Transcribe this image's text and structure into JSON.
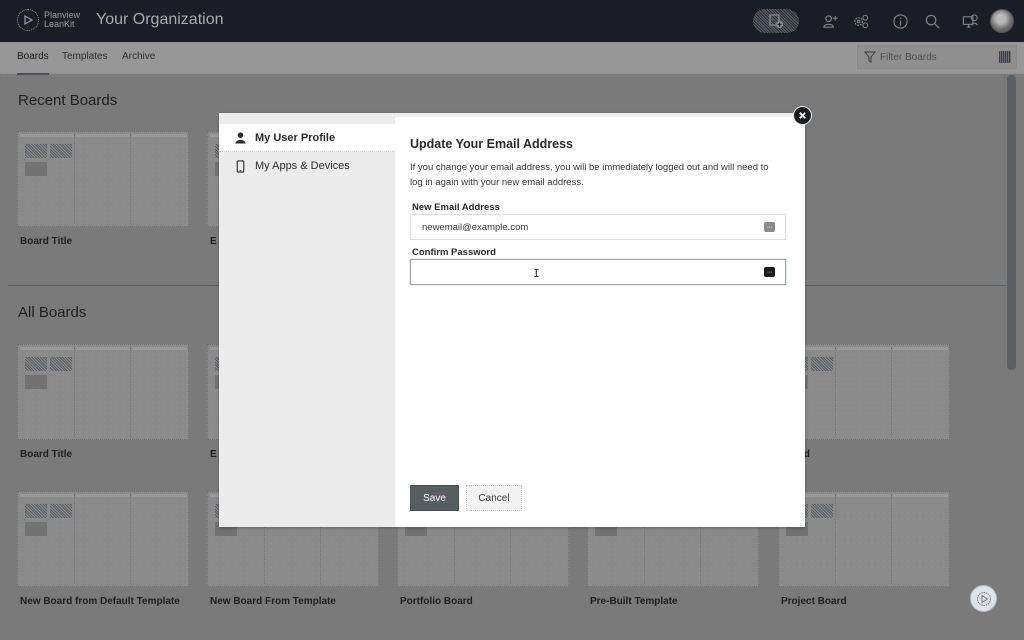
{
  "header": {
    "logo_line1": "Planview",
    "logo_line2": "LeanKit",
    "org_title": "Your Organization",
    "icons": [
      "add-board-icon",
      "invite-user-icon",
      "settings-icon",
      "info-icon",
      "search-icon",
      "support-icon",
      "user-avatar"
    ]
  },
  "subnav": {
    "tabs": [
      {
        "label": "Boards",
        "active": true
      },
      {
        "label": "Templates",
        "active": false
      },
      {
        "label": "Archive",
        "active": false
      }
    ],
    "filter_placeholder": "Filter Boards"
  },
  "content": {
    "recent_title": "Recent Boards",
    "all_title": "All Boards",
    "recent_boards": [
      {
        "title": "Board Title"
      },
      {
        "title": "E"
      }
    ],
    "all_boards_row1": [
      {
        "title": "Board Title"
      },
      {
        "title": "E"
      },
      {
        "title": "Board"
      }
    ],
    "all_boards_row2": [
      {
        "title": "New Board from Default Template"
      },
      {
        "title": "New Board From Template"
      },
      {
        "title": "Portfolio Board"
      },
      {
        "title": "Pre-Built Template"
      },
      {
        "title": "Project Board"
      }
    ]
  },
  "modal": {
    "sidebar": [
      {
        "label": "My User Profile",
        "icon": "user-icon",
        "active": true
      },
      {
        "label": "My Apps & Devices",
        "icon": "phone-icon",
        "active": false
      }
    ],
    "title": "Update Your Email Address",
    "description": "If you change your email address, you will be immediately logged out and will need to log in again with your new email address.",
    "email_label": "New Email Address",
    "email_value": "newemail@example.com",
    "password_label": "Confirm Password",
    "password_value": "",
    "save_label": "Save",
    "cancel_label": "Cancel"
  },
  "colors": {
    "topbar_bg": "#1a1d25",
    "save_button": "#575e62",
    "overlay": "#7a7a7a"
  }
}
